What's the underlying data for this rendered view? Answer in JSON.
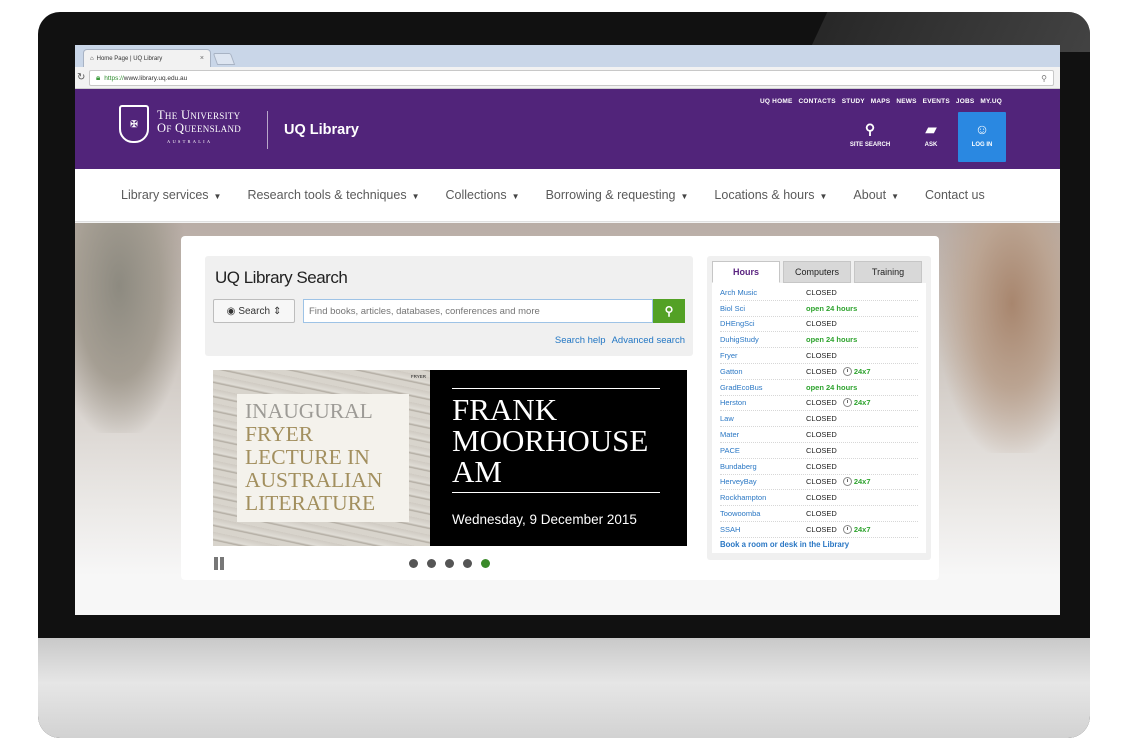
{
  "browser": {
    "tab_title": "Home Page | UQ Library",
    "tab_close": "×",
    "url_scheme": "https://",
    "url_host": "www.library.uq.edu.au"
  },
  "header": {
    "university_line1": "The University",
    "university_line2": "Of Queensland",
    "university_sub": "AUSTRALIA",
    "site_name": "UQ Library",
    "top_links": [
      "UQ HOME",
      "CONTACTS",
      "STUDY",
      "MAPS",
      "NEWS",
      "EVENTS",
      "JOBS",
      "MY.UQ"
    ],
    "site_search_label": "SITE SEARCH",
    "ask_label": "ASK",
    "login_label": "LOG IN"
  },
  "nav": {
    "items": [
      {
        "label": "Library services"
      },
      {
        "label": "Research tools & techniques"
      },
      {
        "label": "Collections"
      },
      {
        "label": "Borrowing & requesting"
      },
      {
        "label": "Locations & hours"
      },
      {
        "label": "About"
      },
      {
        "label": "Contact us"
      }
    ]
  },
  "search": {
    "title": "UQ Library Search",
    "type_label": "Search",
    "placeholder": "Find books, articles, databases, conferences and more",
    "help_link": "Search help",
    "advanced_link": "Advanced search"
  },
  "carousel": {
    "slide_left_line1": "INAUGURAL",
    "slide_left_line2": "FRYER LECTURE IN AUSTRALIAN LITERATURE",
    "slide_left_note": "FRYER",
    "slide_title_line1": "FRANK",
    "slide_title_line2": "MOORHOUSE",
    "slide_title_line3": "AM",
    "slide_date": "Wednesday, 9 December 2015",
    "dot_count": 5,
    "active_dot": 5
  },
  "hours": {
    "tabs": [
      "Hours",
      "Computers",
      "Training"
    ],
    "active_tab": "Hours",
    "rows": [
      {
        "lib": "Arch Music",
        "status": "CLOSED",
        "open": false,
        "x247": ""
      },
      {
        "lib": "Biol Sci",
        "status": "open 24 hours",
        "open": true,
        "x247": ""
      },
      {
        "lib": "DHEngSci",
        "status": "CLOSED",
        "open": false,
        "x247": ""
      },
      {
        "lib": "DuhigStudy",
        "status": "open 24 hours",
        "open": true,
        "x247": ""
      },
      {
        "lib": "Fryer",
        "status": "CLOSED",
        "open": false,
        "x247": ""
      },
      {
        "lib": "Gatton",
        "status": "CLOSED",
        "open": false,
        "x247": "24x7"
      },
      {
        "lib": "GradEcoBus",
        "status": "open 24 hours",
        "open": true,
        "x247": ""
      },
      {
        "lib": "Herston",
        "status": "CLOSED",
        "open": false,
        "x247": "24x7"
      },
      {
        "lib": "Law",
        "status": "CLOSED",
        "open": false,
        "x247": ""
      },
      {
        "lib": "Mater",
        "status": "CLOSED",
        "open": false,
        "x247": ""
      },
      {
        "lib": "PACE",
        "status": "CLOSED",
        "open": false,
        "x247": ""
      },
      {
        "lib": "Bundaberg",
        "status": "CLOSED",
        "open": false,
        "x247": ""
      },
      {
        "lib": "HerveyBay",
        "status": "CLOSED",
        "open": false,
        "x247": "24x7"
      },
      {
        "lib": "Rockhampton",
        "status": "CLOSED",
        "open": false,
        "x247": ""
      },
      {
        "lib": "Toowoomba",
        "status": "CLOSED",
        "open": false,
        "x247": ""
      },
      {
        "lib": "SSAH",
        "status": "CLOSED",
        "open": false,
        "x247": "24x7"
      }
    ],
    "book_link": "Book a room or desk in the Library"
  },
  "colors": {
    "uq_purple": "#51247a",
    "login_blue": "#2a88e1",
    "search_green": "#53a125",
    "link_blue": "#2a77c4",
    "open_green": "#2ea32e"
  }
}
